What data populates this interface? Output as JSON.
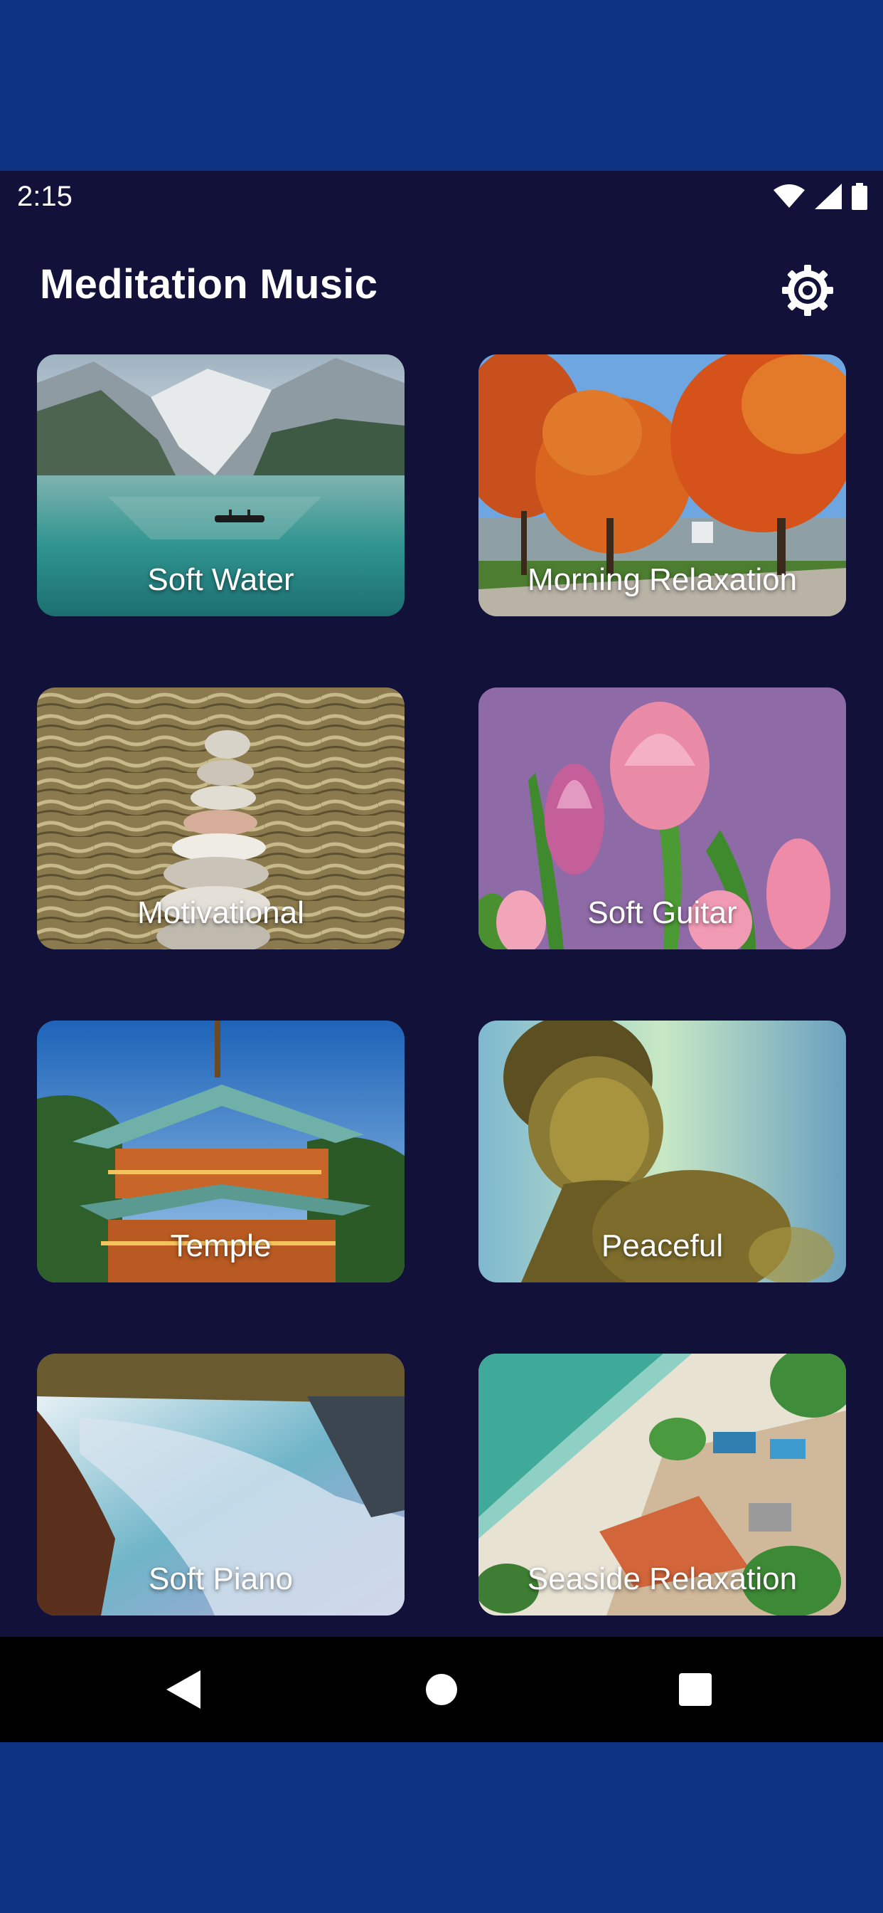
{
  "status_bar": {
    "time": "2:15",
    "icons": [
      "wifi-icon",
      "signal-icon",
      "battery-icon"
    ]
  },
  "app_bar": {
    "title": "Meditation Music",
    "settings_icon": "gear-icon"
  },
  "cards": [
    {
      "label": "Soft Water",
      "image": "mountain-lake-with-boat"
    },
    {
      "label": "Morning Relaxation",
      "image": "autumn-trees-park"
    },
    {
      "label": "Motivational",
      "image": "stacked-stones-water"
    },
    {
      "label": "Soft Guitar",
      "image": "pink-tulips"
    },
    {
      "label": "Temple",
      "image": "japanese-pagoda"
    },
    {
      "label": "Peaceful",
      "image": "buddha-statue"
    },
    {
      "label": "Soft Piano",
      "image": "waterfall"
    },
    {
      "label": "Seaside Relaxation",
      "image": "aerial-beach-village"
    }
  ],
  "nav_bar": {
    "back_icon": "back-triangle-icon",
    "home_icon": "home-circle-icon",
    "recents_icon": "recents-square-icon"
  },
  "colors": {
    "outer_background": "#0e3382",
    "app_background": "#11113a",
    "nav_background": "#000000",
    "text": "#ffffff"
  }
}
